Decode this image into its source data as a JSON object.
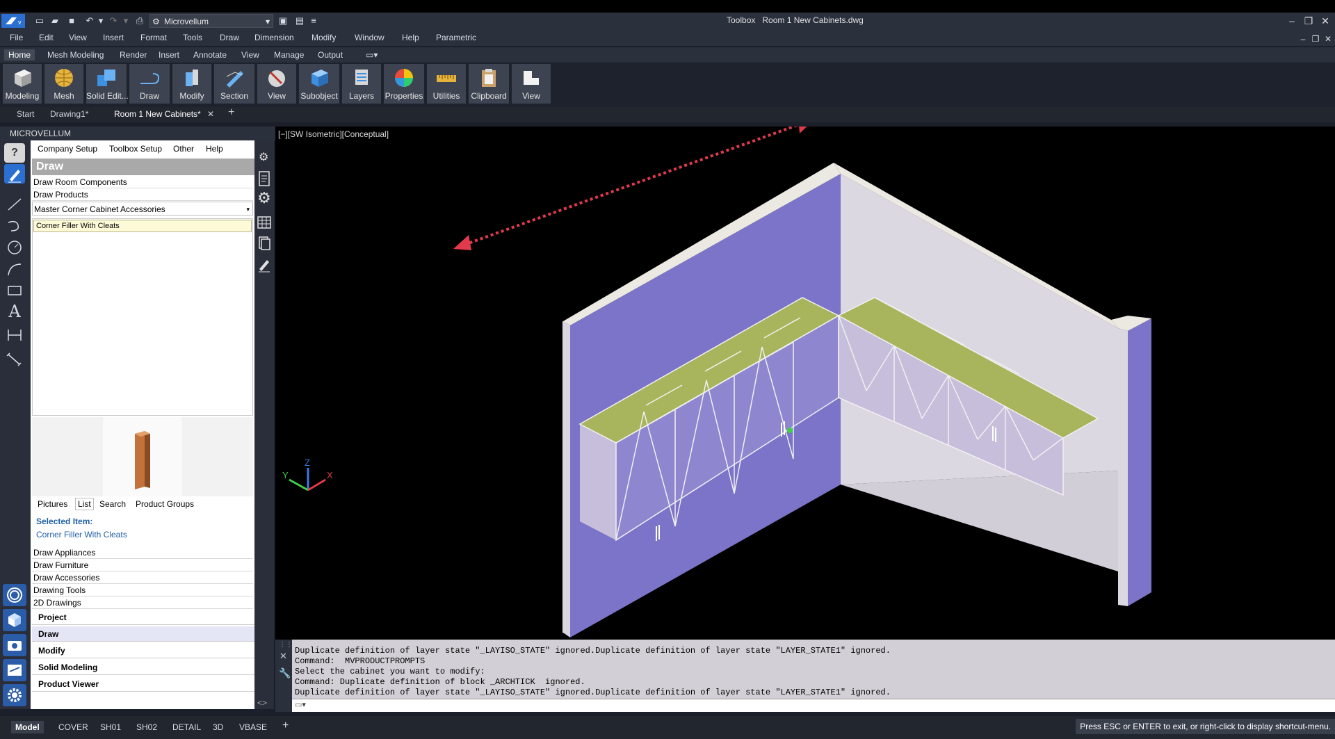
{
  "app": {
    "workspace": "Microvellum",
    "title_prefix": "Toolbox",
    "document": "Room 1 New Cabinets.dwg"
  },
  "menu": [
    "File",
    "Edit",
    "View",
    "Insert",
    "Format",
    "Tools",
    "Draw",
    "Dimension",
    "Modify",
    "Window",
    "Help",
    "Parametric"
  ],
  "ribbon_tabs": [
    "Home",
    "Mesh Modeling",
    "Render",
    "Insert",
    "Annotate",
    "View",
    "Manage",
    "Output"
  ],
  "ribbon_buttons": [
    "Modeling",
    "Mesh",
    "Solid Edit...",
    "Draw",
    "Modify",
    "Section",
    "View",
    "Subobject",
    "Layers",
    "Properties",
    "Utilities",
    "Clipboard",
    "View"
  ],
  "doc_tabs": [
    "Start",
    "Drawing1*",
    "Room 1 New Cabinets*"
  ],
  "left_panel": {
    "header": "MICROVELLUM",
    "menus": [
      "Company Setup",
      "Toolbox Setup",
      "Other",
      "Help"
    ],
    "section_title": "Draw",
    "rows": [
      "Draw Room Components",
      "Draw Products"
    ],
    "dropdown": "Master Corner Cabinet Accessories",
    "selected_list_item": "Corner Filler With Cleats",
    "tabs": [
      "Pictures",
      "List",
      "Search",
      "Product Groups"
    ],
    "selected_label": "Selected Item:",
    "selected_value": "Corner Filler With Cleats",
    "sub_rows": [
      "Draw Appliances",
      "Draw Furniture",
      "Draw Accessories",
      "Drawing Tools",
      "2D Drawings"
    ],
    "accordion": [
      "Project",
      "Draw",
      "Modify",
      "Solid Modeling",
      "Product Viewer"
    ]
  },
  "viewport": {
    "label": "[−][SW Isometric][Conceptual]",
    "ucs": {
      "x": "X",
      "y": "Y",
      "z": "Z"
    }
  },
  "command_lines": [
    "Duplicate definition of layer state \"_LAYISO_STATE\" ignored.Duplicate definition of layer state \"LAYER_STATE1\" ignored.",
    "Command:  MVPRODUCTPROMPTS",
    "Select the cabinet you want to modify:",
    "Command: Duplicate definition of block _ARCHTICK  ignored.",
    "Duplicate definition of layer state \"_LAYISO_STATE\" ignored.Duplicate definition of layer state \"LAYER_STATE1\" ignored."
  ],
  "layout_tabs": [
    "Model",
    "COVER",
    "SH01",
    "SH02",
    "DETAIL",
    "3D",
    "VBASE"
  ],
  "status_message": "Press ESC or ENTER to exit, or right-click to display shortcut-menu.",
  "colors": {
    "accent": "#2b5ca8",
    "wall": "#7b74c8",
    "cabinet_top": "#a9b55c",
    "arrow": "#e23a4a"
  }
}
